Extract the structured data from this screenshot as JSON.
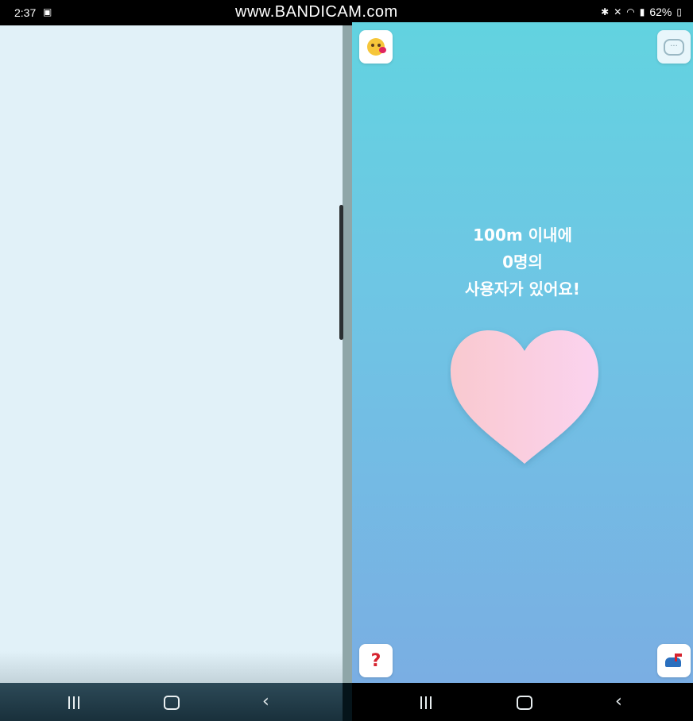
{
  "status_bar": {
    "time": "2:37",
    "watermark": "www.BANDICAM.com",
    "battery": "62%"
  },
  "right_app": {
    "count_lines": [
      "100m 이내에",
      "0명의",
      "사용자가 있어요!"
    ],
    "heart_gradient": [
      "#f9c9cf",
      "#fbd3ef"
    ]
  },
  "nav": {
    "recents_icon": "recents-icon",
    "home_icon": "home-icon",
    "back_icon": "back-icon"
  }
}
